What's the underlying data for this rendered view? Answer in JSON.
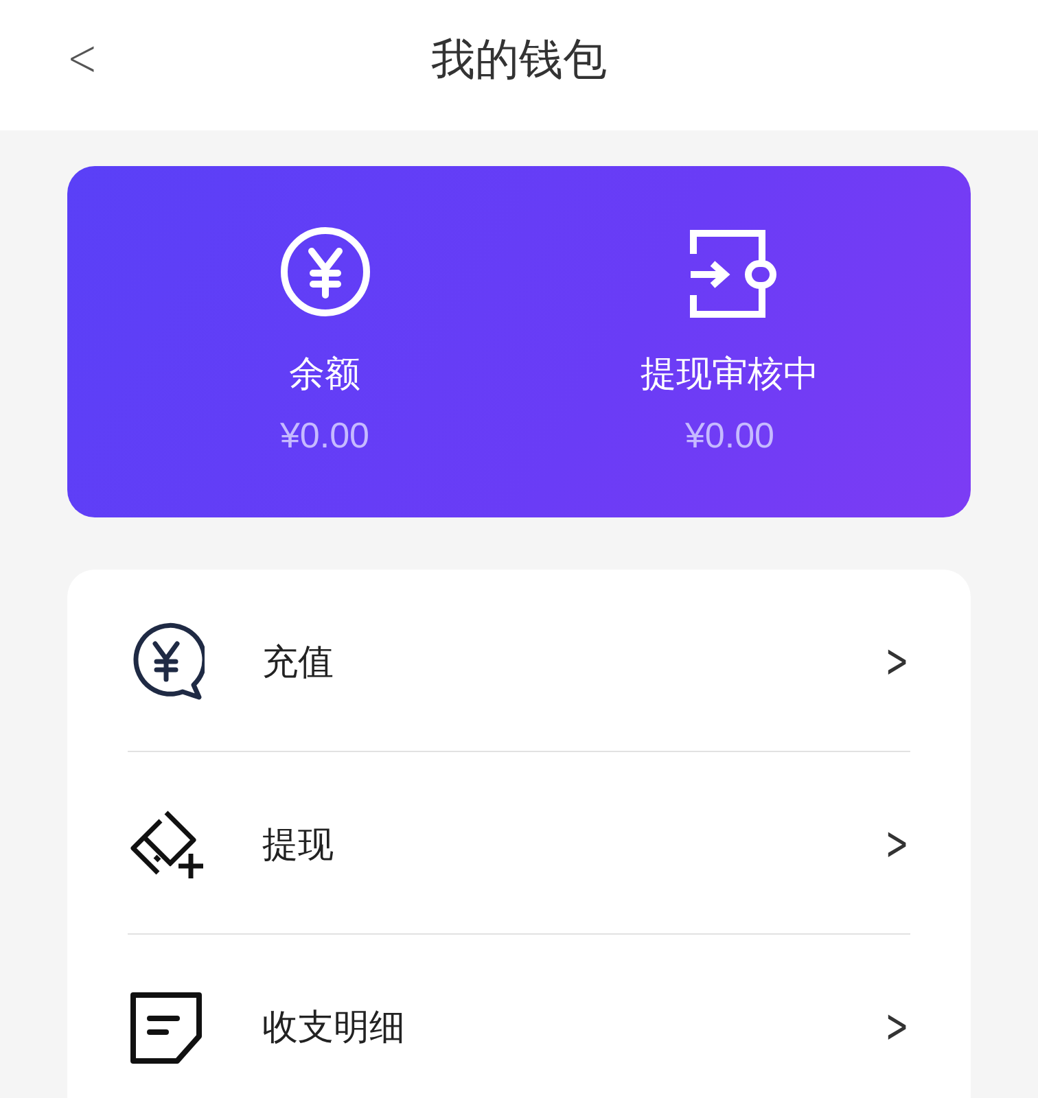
{
  "header": {
    "back": "<",
    "title": "我的钱包"
  },
  "balances": [
    {
      "label": "余额",
      "amount": "¥0.00"
    },
    {
      "label": "提现审核中",
      "amount": "¥0.00"
    }
  ],
  "menu": [
    {
      "label": "充值",
      "chevron": ">"
    },
    {
      "label": "提现",
      "chevron": ">"
    },
    {
      "label": "收支明细",
      "chevron": ">"
    }
  ]
}
